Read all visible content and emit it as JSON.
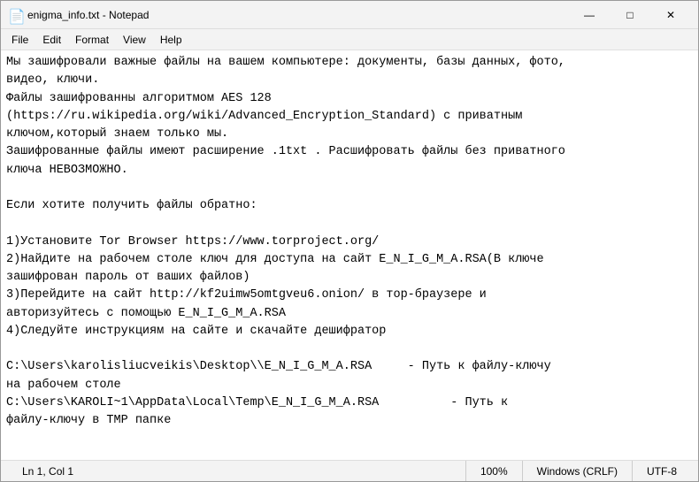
{
  "window": {
    "title": "enigma_info.txt - Notepad",
    "icon": "📄"
  },
  "titlebar": {
    "minimize_label": "—",
    "maximize_label": "□",
    "close_label": "✕"
  },
  "menubar": {
    "items": [
      {
        "id": "file",
        "label": "File"
      },
      {
        "id": "edit",
        "label": "Edit"
      },
      {
        "id": "format",
        "label": "Format"
      },
      {
        "id": "view",
        "label": "View"
      },
      {
        "id": "help",
        "label": "Help"
      }
    ]
  },
  "content": {
    "text": "Мы зашифровали важные файлы на вашем компьютере: документы, базы данных, фото,\nвидео, ключи.\nФайлы зашифрованны алгоритмом AES 128\n(https://ru.wikipedia.org/wiki/Advanced_Encryption_Standard) с приватным\nключом,который знаем только мы.\nЗашифрованные файлы имеют расширение .1txt . Расшифровать файлы без приватного\nключа НЕВОЗМОЖНО.\n\nЕсли хотите получить файлы обратно:\n\n1)Установите Tor Browser https://www.torproject.org/\n2)Найдите на рабочем столе ключ для доступа на сайт E_N_I_G_M_A.RSA(В ключе\nзашифрован пароль от ваших файлов)\n3)Перейдите на сайт http://kf2uimw5omtgveu6.onion/ в тор-браузере и\nавторизуйтесь с помощью E_N_I_G_M_A.RSA\n4)Следуйте инструкциям на сайте и скачайте дешифратор\n\nC:\\Users\\karolisliucveikis\\Desktop\\\\E_N_I_G_M_A.RSA     - Путь к файлу-ключу\nна рабочем столе\nC:\\Users\\KAROLI~1\\AppData\\Local\\Temp\\E_N_I_G_M_A.RSA          - Путь к\nфайлу-ключу в TMP папке"
  },
  "statusbar": {
    "position": "Ln 1, Col 1",
    "zoom": "100%",
    "line_ending": "Windows (CRLF)",
    "encoding": "UTF-8"
  }
}
